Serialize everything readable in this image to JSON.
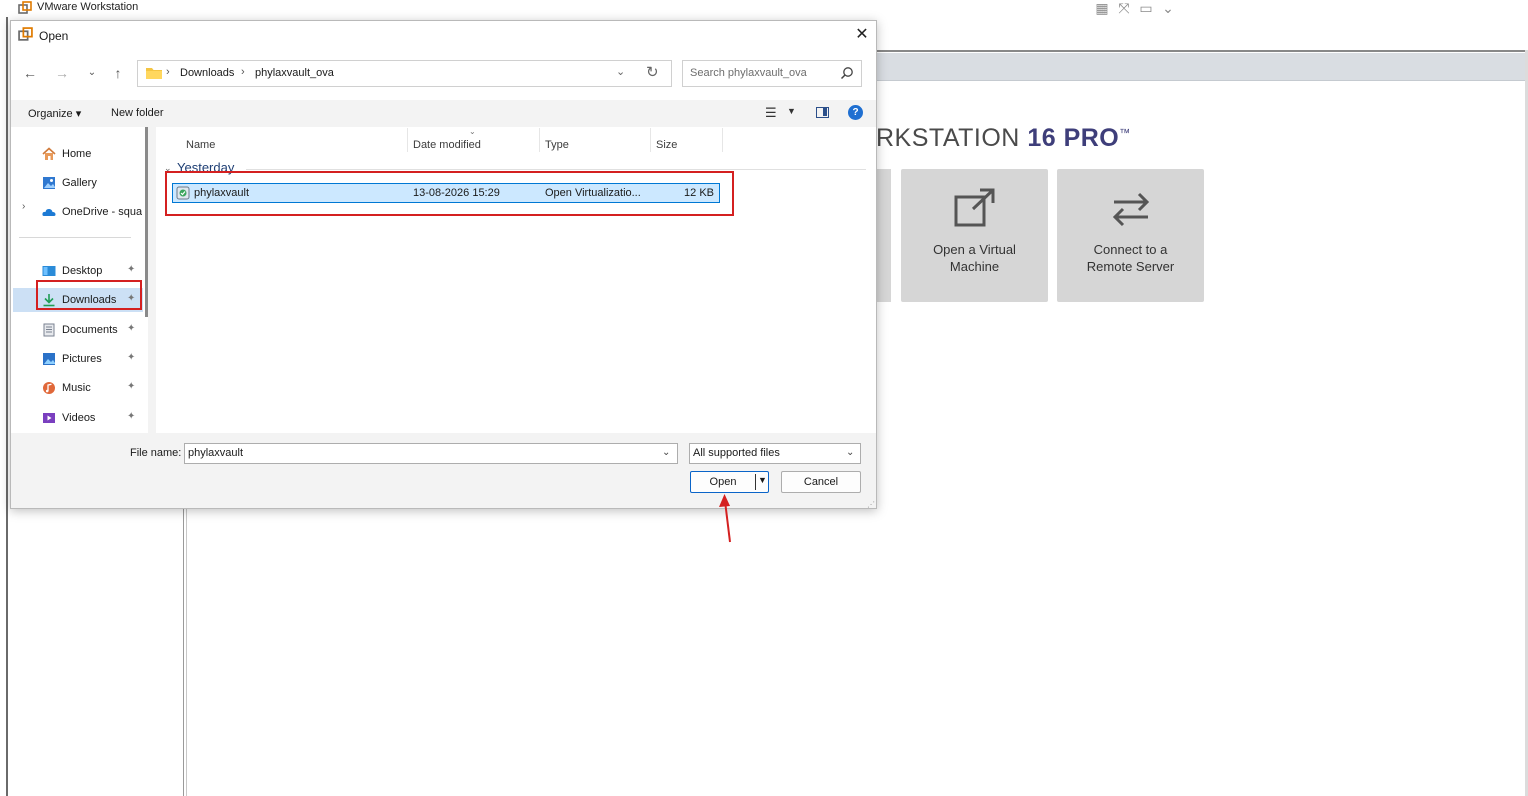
{
  "vmware": {
    "window_title": "VMware Workstation",
    "brand_text_a": "RKSTATION ",
    "brand_text_b": "16 PRO",
    "brand_tm": "™",
    "tiles": [
      {
        "label_line1": "Open a Virtual",
        "label_line2": "Machine",
        "icon": "open-external-icon"
      },
      {
        "label_line1": "Connect to a",
        "label_line2": "Remote Server",
        "icon": "swap-arrows-icon"
      }
    ]
  },
  "dialog": {
    "title": "Open",
    "close_glyph": "✕",
    "nav": {
      "back": "←",
      "forward": "→",
      "recent": "⌄",
      "up": "↑"
    },
    "address": {
      "crumbs": [
        "Downloads",
        "phylaxvault_ova"
      ],
      "separator": "›"
    },
    "search_placeholder": "Search phylaxvault_ova",
    "toolbar": {
      "organize": "Organize ▾",
      "new_folder": "New folder"
    },
    "sidebar": {
      "items": [
        {
          "label": "Home",
          "icon": "home-icon",
          "pinned": false
        },
        {
          "label": "Gallery",
          "icon": "gallery-icon",
          "pinned": false
        },
        {
          "label": "OneDrive - squa",
          "icon": "onedrive-icon",
          "pinned": false
        },
        {
          "label": "Desktop",
          "icon": "desktop-icon",
          "pinned": true
        },
        {
          "label": "Downloads",
          "icon": "downloads-icon",
          "pinned": true,
          "selected": true
        },
        {
          "label": "Documents",
          "icon": "documents-icon",
          "pinned": true
        },
        {
          "label": "Pictures",
          "icon": "pictures-icon",
          "pinned": true
        },
        {
          "label": "Music",
          "icon": "music-icon",
          "pinned": true
        },
        {
          "label": "Videos",
          "icon": "videos-icon",
          "pinned": true
        }
      ],
      "pin_glyph": "📌"
    },
    "columns": [
      "Name",
      "Date modified",
      "Type",
      "Size"
    ],
    "group_label": "Yesterday",
    "files": [
      {
        "name": "phylaxvault",
        "date": "13-08-2026 15:29",
        "type": "Open Virtualizatio...",
        "size": "12 KB",
        "selected": true
      }
    ],
    "footer": {
      "file_name_label": "File name:",
      "file_name_value": "phylaxvault",
      "filter_value": "All supported files",
      "open_label": "Open",
      "cancel_label": "Cancel"
    }
  },
  "colors": {
    "accent": "#0078d4",
    "annotation": "#d42020",
    "selection": "#cce8ff",
    "brand": "#3e3e7a"
  }
}
